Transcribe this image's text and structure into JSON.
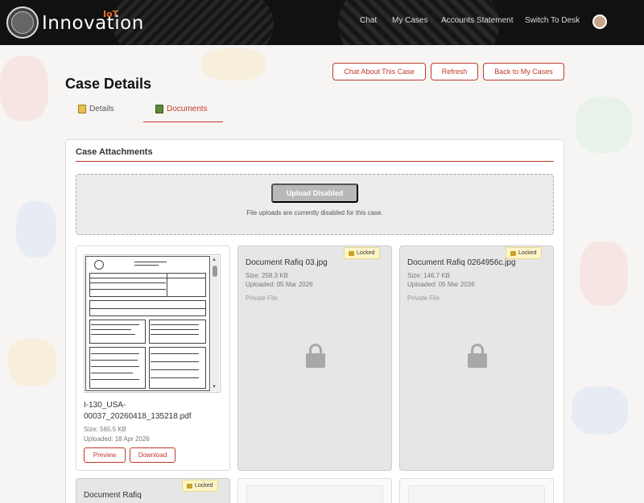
{
  "header": {
    "brand": "Innovation",
    "brand_sup": "IoT",
    "nav": [
      "Chat",
      "My Cases",
      "Accounts Statement",
      "Switch To Desk"
    ]
  },
  "page": {
    "title": "Case Details",
    "actions": {
      "chat": "Chat About This Case",
      "refresh": "Refresh",
      "back": "Back to My Cases"
    },
    "tabs": [
      {
        "label": "Details",
        "active": false
      },
      {
        "label": "Documents",
        "active": true
      }
    ]
  },
  "attachments": {
    "title": "Case Attachments",
    "upload_button": "Upload Disabled",
    "upload_note": "File uploads are currently disabled for this case.",
    "files": [
      {
        "name_line1": "I-130_USA-",
        "name_line2": "00037_20260418_135218.pdf",
        "size": "Size: 565.5 KB",
        "uploaded": "Uploaded: 18 Apr 2026",
        "preview": "Preview",
        "download": "Download"
      },
      {
        "name": "Document Rafiq 03.jpg",
        "size": "Size: 258.3 KB",
        "uploaded": "Uploaded: 05 Mar 2026",
        "privacy": "Private File",
        "badge": "Locked"
      },
      {
        "name": "Document Rafiq 0264956c.jpg",
        "size": "Size: 146.7 KB",
        "uploaded": "Uploaded: 05 Mar 2026",
        "privacy": "Private File",
        "badge": "Locked"
      },
      {
        "name": "Document Rafiq",
        "badge": "Locked"
      }
    ]
  },
  "colors": {
    "accent": "#c0392b",
    "header_bg": "#111111",
    "locked_card": "#e6e6e6",
    "badge_bg": "#fdf5c9"
  },
  "icons": [
    "seal-icon",
    "user-avatar-icon",
    "details-tab-icon",
    "documents-tab-icon",
    "lock-icon",
    "scroll-up-icon",
    "scroll-down-icon"
  ]
}
